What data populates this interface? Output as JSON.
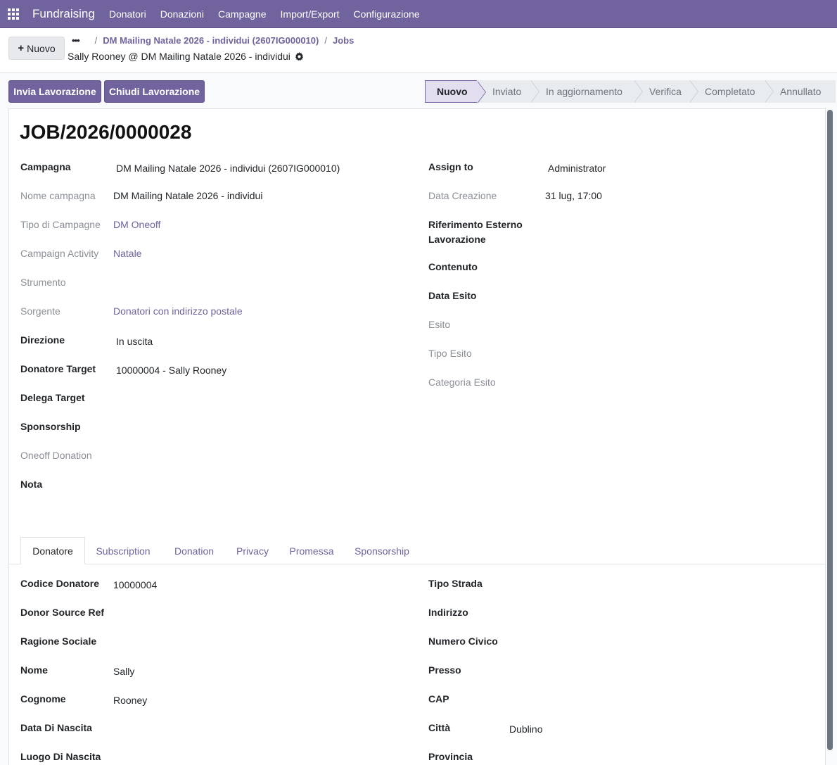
{
  "navbar": {
    "brand": "Fundraising",
    "items": [
      "Donatori",
      "Donazioni",
      "Campagne",
      "Import/Export",
      "Configurazione"
    ]
  },
  "control": {
    "new_label": "Nuovo",
    "breadcrumb_campaign": "DM Mailing Natale 2026 - individui (2607IG000010)",
    "breadcrumb_jobs": "Jobs",
    "record_title": "Sally Rooney @ DM Mailing Natale 2026 - individui"
  },
  "actions": {
    "send": "Invia Lavorazione",
    "close": "Chiudi Lavorazione"
  },
  "statusbar": [
    "Nuovo",
    "Inviato",
    "In aggiornamento",
    "Verifica",
    "Completato",
    "Annullato"
  ],
  "form": {
    "title": "JOB/2026/0000028",
    "left": [
      {
        "label": "Campagna",
        "value": "DM Mailing Natale 2026 -  individui (2607IG000010)"
      },
      {
        "label": "Nome campagna",
        "value": "DM Mailing Natale 2026 - individui"
      },
      {
        "label": "Tipo di Campagne",
        "value": "DM Oneoff"
      },
      {
        "label": "Campaign Activity",
        "value": "Natale"
      },
      {
        "label": "Strumento",
        "value": ""
      },
      {
        "label": "Sorgente",
        "value": "Donatori con indirizzo postale"
      },
      {
        "label": "Direzione",
        "value": "In uscita"
      },
      {
        "label": "Donatore Target",
        "value": "10000004 - Sally Rooney"
      },
      {
        "label": "Delega Target",
        "value": ""
      },
      {
        "label": "Sponsorship",
        "value": ""
      },
      {
        "label": "Oneoff Donation",
        "value": ""
      },
      {
        "label": "Nota",
        "value": ""
      }
    ],
    "right": [
      {
        "label": "Assign to",
        "value": "Administrator"
      },
      {
        "label": "Data Creazione",
        "value": "31 lug, 17:00"
      },
      {
        "label": "Riferimento Esterno",
        "label2": "Lavorazione",
        "value": ""
      },
      {
        "label": "Contenuto",
        "value": ""
      },
      {
        "label": "Data Esito",
        "value": ""
      },
      {
        "label": "Esito",
        "value": ""
      },
      {
        "label": "Tipo Esito",
        "value": ""
      },
      {
        "label": "Categoria Esito",
        "value": ""
      }
    ]
  },
  "tabs": [
    "Donatore",
    "Subscription",
    "Donation",
    "Privacy",
    "Promessa",
    "Sponsorship"
  ],
  "donor": {
    "left": [
      {
        "label": "Codice Donatore",
        "value": "10000004"
      },
      {
        "label": "Donor Source Ref",
        "value": ""
      },
      {
        "label": "Ragione Sociale",
        "value": ""
      },
      {
        "label": "Nome",
        "value": "Sally"
      },
      {
        "label": "Cognome",
        "value": "Rooney"
      },
      {
        "label": "Data Di Nascita",
        "value": ""
      },
      {
        "label": "Luogo Di Nascita",
        "value": ""
      }
    ],
    "right": [
      {
        "label": "Tipo Strada",
        "value": ""
      },
      {
        "label": "Indirizzo",
        "value": ""
      },
      {
        "label": "Numero Civico",
        "value": ""
      },
      {
        "label": "Presso",
        "value": ""
      },
      {
        "label": "CAP",
        "value": ""
      },
      {
        "label": "Città",
        "value": "Dublino"
      },
      {
        "label": "Provincia",
        "value": ""
      }
    ]
  }
}
